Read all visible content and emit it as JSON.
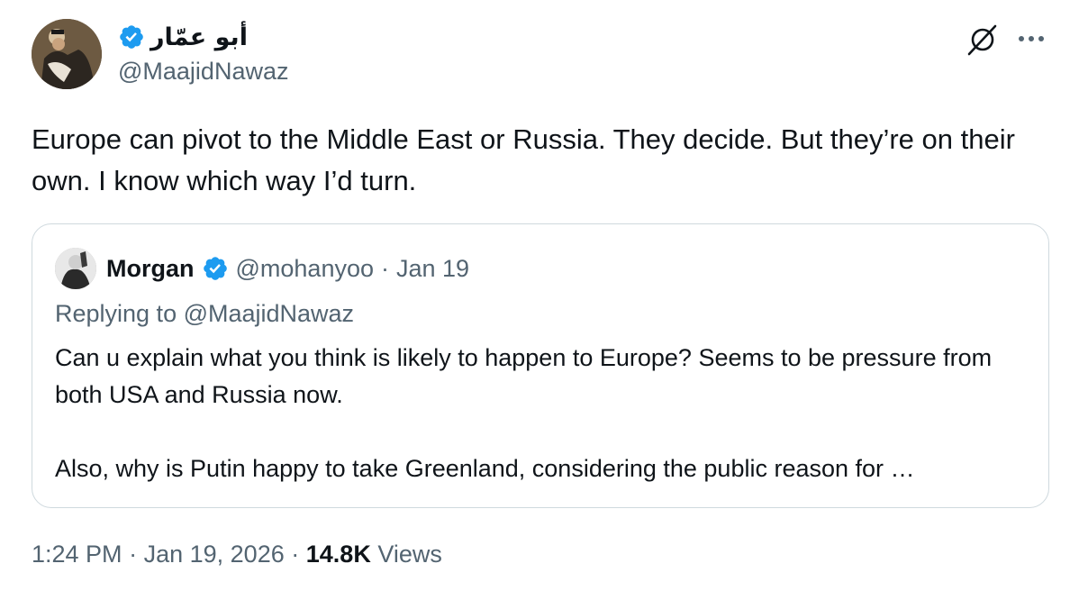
{
  "author": {
    "display_name": "أبو عمّار",
    "handle": "@MaajidNawaz",
    "verified": true
  },
  "tweet": {
    "text": "Europe can pivot to the Middle East or Russia. They decide. But they’re on their own. I know which way I’d turn."
  },
  "quoted_tweet": {
    "name": "Morgan",
    "verified": true,
    "handle": "@mohanyoo",
    "separator": "·",
    "date": "Jan 19",
    "replying_to": "Replying to @MaajidNawaz",
    "paragraph_1": "Can u explain what you think is likely to happen to Europe? Seems to be pressure from both USA and Russia now.",
    "paragraph_2": "Also, why is Putin happy to take Greenland, considering the public reason for …"
  },
  "footer": {
    "time": "1:24 PM",
    "sep1": "·",
    "date": "Jan 19, 2026",
    "sep2": "·",
    "views_count": "14.8K",
    "views_label": "Views"
  },
  "colors": {
    "verified": "#1d9bf0",
    "secondary_text": "#536471",
    "primary_text": "#0f1419",
    "border": "#cfd9de"
  },
  "icons": {
    "verified": "verified-badge-icon",
    "grok": "grok-icon",
    "more": "more-options-icon"
  }
}
